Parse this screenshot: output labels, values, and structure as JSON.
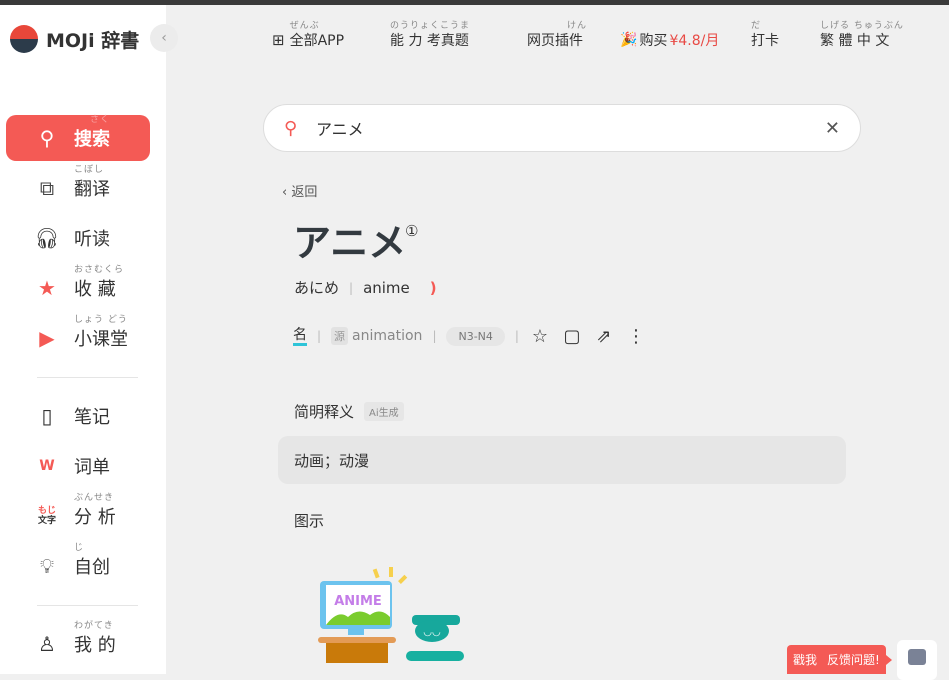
{
  "app": {
    "logo_text": "MOJi 辞書"
  },
  "header": {
    "items": [
      {
        "label": "全部APP",
        "ruby": "ぜんぶ"
      },
      {
        "label": "能 力 考真题",
        "ruby": "のうりょくこうま"
      },
      {
        "label": "网页插件",
        "ruby": "けん"
      },
      {
        "label": "购买",
        "price": "¥4.8/月"
      },
      {
        "label": "打卡",
        "ruby": "だ"
      },
      {
        "label": "繁 體 中 文",
        "ruby": "しげる ちゅうぶん"
      }
    ]
  },
  "sidebar": {
    "items": [
      {
        "label": "搜索",
        "ruby": "さく"
      },
      {
        "label": "翻译",
        "ruby": "こぼし"
      },
      {
        "label": "听读",
        "ruby": ""
      },
      {
        "label": "收 藏",
        "ruby": "おさむくら"
      },
      {
        "label": "小课堂",
        "ruby": "しょう どう"
      },
      {
        "label": "笔记",
        "ruby": ""
      },
      {
        "label": "词单",
        "ruby": ""
      },
      {
        "label": "分 析",
        "ruby": "ぶんせき",
        "icon_text": "もじ文字"
      },
      {
        "label": "自创",
        "ruby": "じ"
      },
      {
        "label": "我 的",
        "ruby": "わがてき"
      }
    ]
  },
  "search": {
    "value": "アニメ"
  },
  "entry": {
    "back": "返回",
    "word": "アニメ",
    "tone": "①",
    "kana": "あにめ",
    "romaji": "anime",
    "pos": "名",
    "source_tag": "源",
    "source": "animation",
    "level": "N3-N4",
    "brief_title": "简明释义",
    "ai_badge": "Ai生成",
    "definition": "动画；动漫",
    "illustration_title": "图示",
    "illustration_text": "ANIME"
  },
  "feedback": {
    "label1": "戳我",
    "label2": "反馈问题!"
  },
  "colors": {
    "accent": "#f45a55",
    "pos_underline": "#2ec4d8"
  }
}
